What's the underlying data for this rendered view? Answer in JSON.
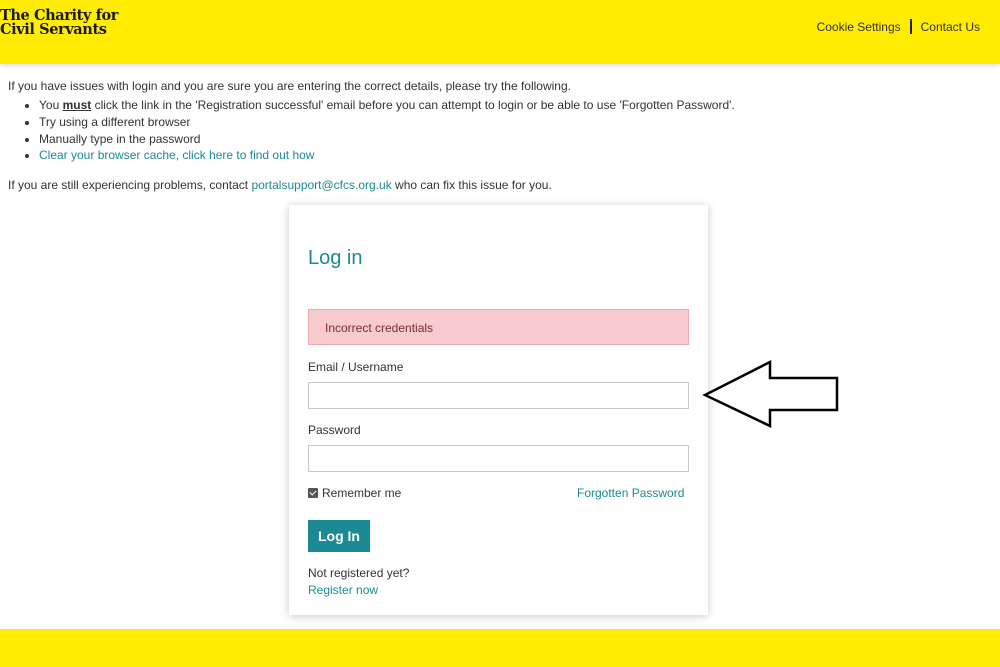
{
  "header": {
    "logo_line1": "The Charity for",
    "logo_line2": "Civil Servants",
    "cookie_settings": "Cookie Settings",
    "contact_us": "Contact Us"
  },
  "info": {
    "intro": "If you have issues with login and you are sure you are entering the correct details, please try the following.",
    "bullet1_pre": "You ",
    "bullet1_must": "must",
    "bullet1_post": " click the link in the 'Registration successful' email before you can attempt to login or be able to use 'Forgotten Password'.",
    "bullet2": "Try using a different browser",
    "bullet3": "Manually type in the password",
    "bullet4_link": "Clear your browser cache, click here to find out how",
    "contact_pre": "If you are still experiencing problems, contact ",
    "contact_email": "portalsupport@cfcs.org.uk",
    "contact_post": " who can fix this issue for you."
  },
  "login": {
    "title": "Log in",
    "error": "Incorrect credentials",
    "email_label": "Email / Username",
    "email_value": "",
    "password_label": "Password",
    "password_value": "",
    "remember_me": "Remember me",
    "forgotten_password": "Forgotten Password",
    "button": "Log In",
    "not_registered": "Not registered yet?",
    "register_now": "Register now"
  },
  "colors": {
    "brand_yellow": "#FFEC00",
    "accent_teal": "#1B8A92",
    "error_bg": "#F8CBCE"
  },
  "icons": {
    "arrow": "arrow-left-icon",
    "checkbox": "checkbox-checked-icon"
  }
}
